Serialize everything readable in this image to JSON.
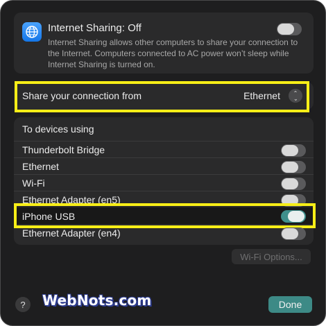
{
  "internet_sharing": {
    "title": "Internet Sharing: Off",
    "description": "Internet Sharing allows other computers to share your connection to the Internet. Computers connected to AC power won’t sleep while Internet Sharing is turned on.",
    "enabled": false
  },
  "share_from": {
    "label": "Share your connection from",
    "value": "Ethernet"
  },
  "devices": {
    "header": "To devices using",
    "items": [
      {
        "label": "Thunderbolt Bridge",
        "enabled": false
      },
      {
        "label": "Ethernet",
        "enabled": false
      },
      {
        "label": "Wi-Fi",
        "enabled": false
      },
      {
        "label": "Ethernet Adapter (en5)",
        "enabled": false
      },
      {
        "label": "iPhone USB",
        "enabled": true
      },
      {
        "label": "Ethernet Adapter (en4)",
        "enabled": false
      }
    ]
  },
  "buttons": {
    "wifi_options": "Wi-Fi Options...",
    "help": "?",
    "done": "Done"
  },
  "watermark": "WebNots.com",
  "colors": {
    "highlight": "#f7ee17",
    "accent": "#3d8a86",
    "background": "#1e1e1f"
  }
}
